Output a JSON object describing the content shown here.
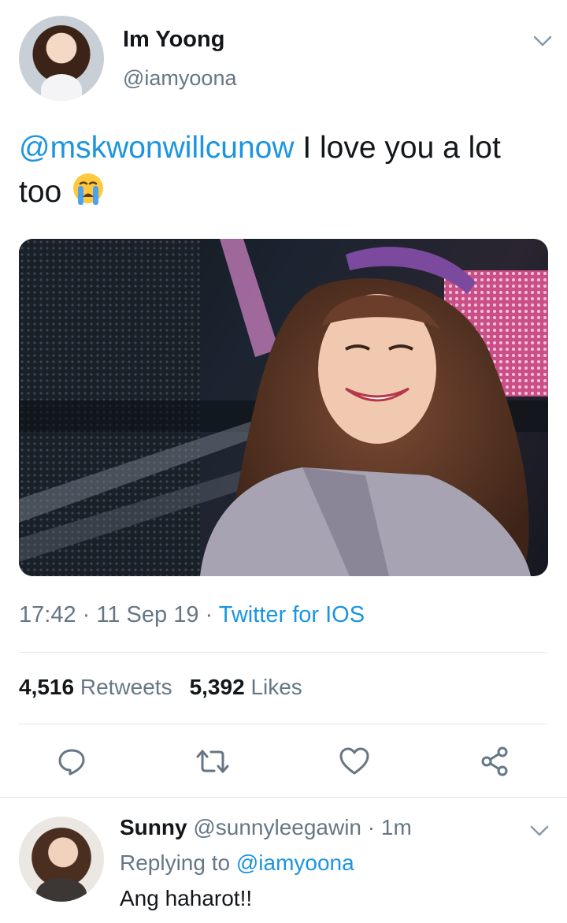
{
  "tweet": {
    "author_name": "Im Yoong",
    "author_handle": "@iamyoona",
    "mention": "@mskwonwillcunow",
    "text": " I love you a lot too",
    "emoji": "loudly-crying-face-emoji",
    "time": "17:42",
    "date": "11 Sep 19",
    "source": "Twitter for IOS",
    "retweets_count": "4,516",
    "retweets_label": "Retweets",
    "likes_count": "5,392",
    "likes_label": "Likes",
    "media": "photo-performer-smiling-on-stage"
  },
  "actions": [
    "reply-icon",
    "retweet-icon",
    "like-icon",
    "share-icon"
  ],
  "reply": {
    "author_name": "Sunny",
    "author_handle": "@sunnyleegawin",
    "age": "1m",
    "replying_to_label": "Replying to",
    "replying_to_handle": "@iamyoona",
    "text": "Ang haharot!!"
  },
  "colors": {
    "accent": "#1b95e0",
    "secondary_text": "#657786",
    "primary_text": "#14171a",
    "divider": "#e1e8ed"
  }
}
